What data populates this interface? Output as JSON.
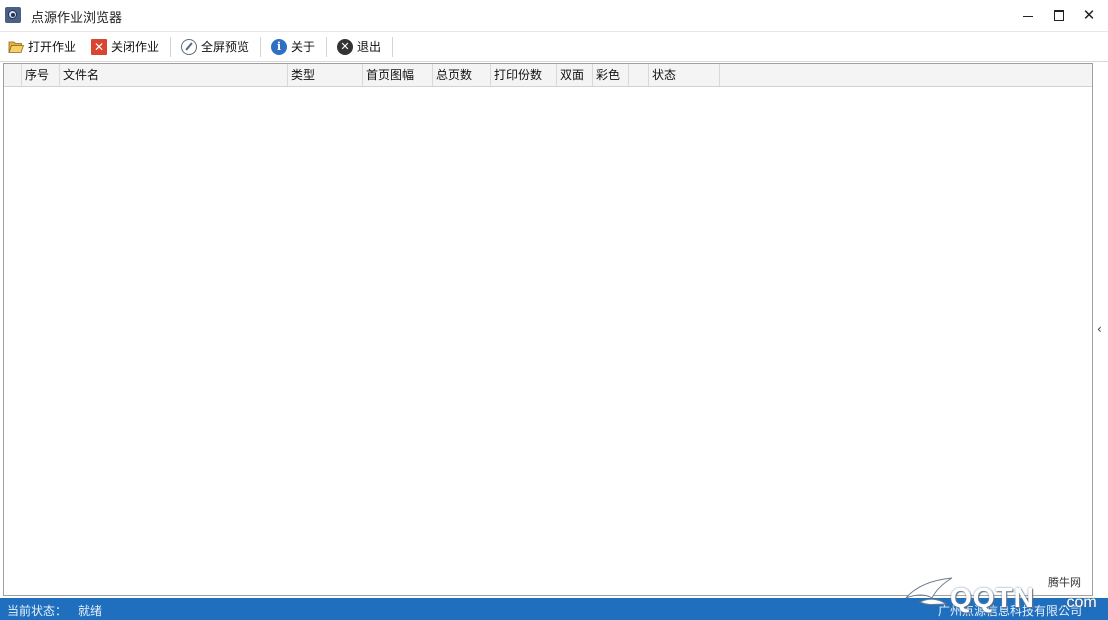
{
  "window": {
    "title": "点源作业浏览器"
  },
  "toolbar": {
    "items": [
      {
        "label": "打开作业",
        "icon": "folder-open-icon"
      },
      {
        "label": "关闭作业",
        "icon": "close-job-icon"
      },
      {
        "label": "全屏预览",
        "icon": "compass-icon"
      },
      {
        "label": "关于",
        "icon": "info-icon"
      },
      {
        "label": "退出",
        "icon": "exit-icon"
      }
    ]
  },
  "grid": {
    "columns": [
      "",
      "序号",
      "文件名",
      "类型",
      "首页图幅",
      "总页数",
      "打印份数",
      "双面",
      "彩色",
      "",
      "状态"
    ],
    "rows": []
  },
  "status": {
    "label": "当前状态：",
    "value": "就绪",
    "company": "广州点源信息科技有限公司"
  },
  "watermark": {
    "brand": "QQTN",
    "suffix": ".com",
    "cn": "腾牛网"
  },
  "colors": {
    "statusbar": "#1f6fbe",
    "header": "#f4f4f4"
  }
}
